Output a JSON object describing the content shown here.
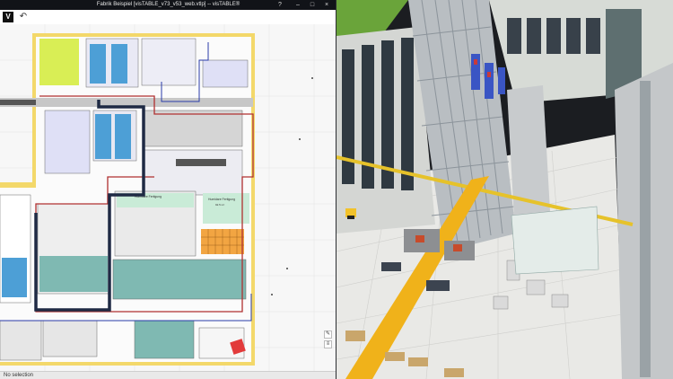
{
  "window": {
    "title": "Fabrik Beispiel [visTABLE_v73_v53_web.vtlp] -- visTABLE®",
    "help": "?",
    "minimize": "–",
    "maximize": "□",
    "close": "×"
  },
  "toolbar": {
    "logo": "V",
    "undo": "↶"
  },
  "plan": {
    "area_label_1": "Humidare Fertigung",
    "area_label_2": "Humidare Fertigung",
    "area_sub": "92.5 m²"
  },
  "status": {
    "text": "No selection"
  },
  "colors": {
    "wall": "#f3d86a",
    "corridor": "#c7c7c7",
    "zone_blue": "#4d9fd6",
    "zone_teal": "#7fb9b2",
    "zone_lavender": "#dfe0f6",
    "route_red": "#b03030",
    "route_dark": "#1f2a44",
    "route_blue": "#2a3ba8",
    "rail_yellow": "#e6b800"
  },
  "icons": [
    "logo-icon",
    "undo-icon",
    "help-icon",
    "pencil-icon",
    "layers-icon"
  ]
}
